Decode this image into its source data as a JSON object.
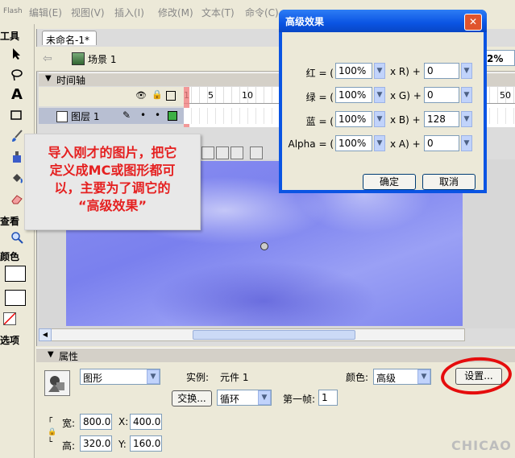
{
  "menu": {
    "app_logo": "Flash",
    "items": [
      "编辑(E)",
      "视图(V)",
      "插入(I)",
      "修改(M)",
      "文本(T)",
      "命令(C)"
    ]
  },
  "tools_panel": {
    "title": "工具",
    "view_label": "查看",
    "colors_label": "颜色",
    "options_label": "选项"
  },
  "document": {
    "tab_title": "未命名-1*",
    "scene_label": "场景 1",
    "zoom": "2%"
  },
  "timeline": {
    "title": "时间轴",
    "frame_numbers": [
      "1",
      "5",
      "10",
      "15",
      "50"
    ],
    "layer_name": "图层 1"
  },
  "callout": {
    "lines": [
      "导入刚才的图片，把它",
      "定义成MC或图形都可",
      "以，主要为了调它的",
      "“高级效果”"
    ]
  },
  "dialog": {
    "title": "高级效果",
    "rows": [
      {
        "label": "红 = (",
        "percent": "100%",
        "channel": "x R) +",
        "offset": "0"
      },
      {
        "label": "绿 = (",
        "percent": "100%",
        "channel": "x G) +",
        "offset": "0"
      },
      {
        "label": "蓝 = (",
        "percent": "100%",
        "channel": "x B) +",
        "offset": "128"
      },
      {
        "label": "Alpha = (",
        "percent": "100%",
        "channel": "x A) +",
        "offset": "0"
      }
    ],
    "ok_label": "确定",
    "cancel_label": "取消"
  },
  "properties": {
    "title": "属性",
    "type_value": "图形",
    "instance_label": "实例:",
    "instance_value": "元件 1",
    "swap_label": "交换...",
    "loop_value": "循环",
    "first_frame_label": "第一帧:",
    "first_frame_value": "1",
    "color_label": "颜色:",
    "color_value": "高级",
    "settings_label": "设置...",
    "width_label": "宽:",
    "width_value": "800.0",
    "height_label": "高:",
    "height_value": "320.0",
    "x_label": "X:",
    "x_value": "400.0",
    "y_label": "Y:",
    "y_value": "160.0"
  },
  "watermark": "CHICAO"
}
